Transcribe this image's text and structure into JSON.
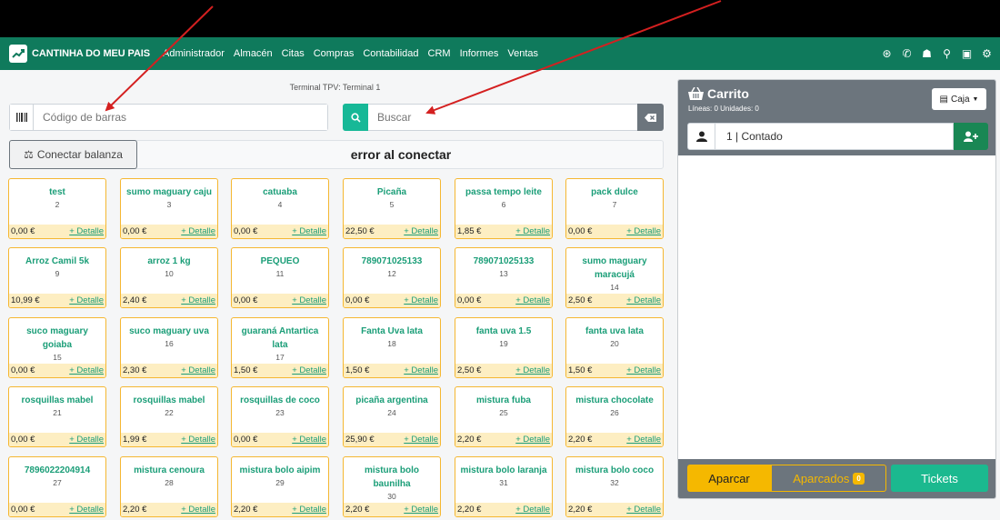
{
  "app": {
    "brand": "CANTINHA DO MEU PAIS",
    "menu": [
      "Administrador",
      "Almacén",
      "Citas",
      "Compras",
      "Contabilidad",
      "CRM",
      "Informes",
      "Ventas"
    ],
    "top_icons": [
      "help-icon",
      "whatsapp-icon",
      "users-icon",
      "search-icon",
      "user-settings-icon",
      "gear-icon"
    ],
    "accent": "#0f7a5c"
  },
  "pos": {
    "terminal_label": "Terminal TPV: Terminal 1",
    "barcode_placeholder": "Código de barras",
    "search_placeholder": "Buscar",
    "scale_button": "Conectar balanza",
    "scale_status": "error al conectar",
    "detail_label": "+ Detalle"
  },
  "products": [
    {
      "name": "test",
      "code": "2",
      "price": "0,00 €"
    },
    {
      "name": "sumo maguary caju",
      "code": "3",
      "price": "0,00 €"
    },
    {
      "name": "catuaba",
      "code": "4",
      "price": "0,00 €"
    },
    {
      "name": "Picaña",
      "code": "5",
      "price": "22,50 €"
    },
    {
      "name": "passa tempo leite",
      "code": "6",
      "price": "1,85 €"
    },
    {
      "name": "pack dulce",
      "code": "7",
      "price": "0,00 €"
    },
    {
      "name": "Arroz Camil 5k",
      "code": "9",
      "price": "10,99 €"
    },
    {
      "name": "arroz 1 kg",
      "code": "10",
      "price": "2,40 €"
    },
    {
      "name": "PEQUEO",
      "code": "11",
      "price": "0,00 €"
    },
    {
      "name": "789071025133",
      "code": "12",
      "price": "0,00 €"
    },
    {
      "name": "789071025133",
      "code": "13",
      "price": "0,00 €"
    },
    {
      "name": "sumo maguary maracujá",
      "code": "14",
      "price": "2,50 €"
    },
    {
      "name": "suco maguary goiaba",
      "code": "15",
      "price": "0,00 €"
    },
    {
      "name": "suco maguary uva",
      "code": "16",
      "price": "2,30 €"
    },
    {
      "name": "guaraná Antartica lata",
      "code": "17",
      "price": "1,50 €"
    },
    {
      "name": "Fanta Uva lata",
      "code": "18",
      "price": "1,50 €"
    },
    {
      "name": "fanta uva 1.5",
      "code": "19",
      "price": "2,50 €"
    },
    {
      "name": "fanta uva lata",
      "code": "20",
      "price": "1,50 €"
    },
    {
      "name": "rosquillas mabel",
      "code": "21",
      "price": "0,00 €"
    },
    {
      "name": "rosquillas mabel",
      "code": "22",
      "price": "1,99 €"
    },
    {
      "name": "rosquillas de coco",
      "code": "23",
      "price": "0,00 €"
    },
    {
      "name": "picaña argentina",
      "code": "24",
      "price": "25,90 €"
    },
    {
      "name": "mistura fuba",
      "code": "25",
      "price": "2,20 €"
    },
    {
      "name": "mistura chocolate",
      "code": "26",
      "price": "2,20 €"
    },
    {
      "name": "7896022204914",
      "code": "27",
      "price": "0,00 €"
    },
    {
      "name": "mistura cenoura",
      "code": "28",
      "price": "2,20 €"
    },
    {
      "name": "mistura bolo aipim",
      "code": "29",
      "price": "2,20 €"
    },
    {
      "name": "mistura bolo baunilha",
      "code": "30",
      "price": "2,20 €"
    },
    {
      "name": "mistura bolo laranja",
      "code": "31",
      "price": "2,20 €"
    },
    {
      "name": "mistura bolo coco",
      "code": "32",
      "price": "2,20 €"
    }
  ],
  "cart": {
    "title": "Carrito",
    "subtitle": "Líneas: 0 Unidades: 0",
    "cash_button": "Caja",
    "customer": "1 | Contado",
    "park_button": "Aparcar",
    "parked_button": "Aparcados",
    "parked_count": "0",
    "tickets_button": "Tickets"
  }
}
